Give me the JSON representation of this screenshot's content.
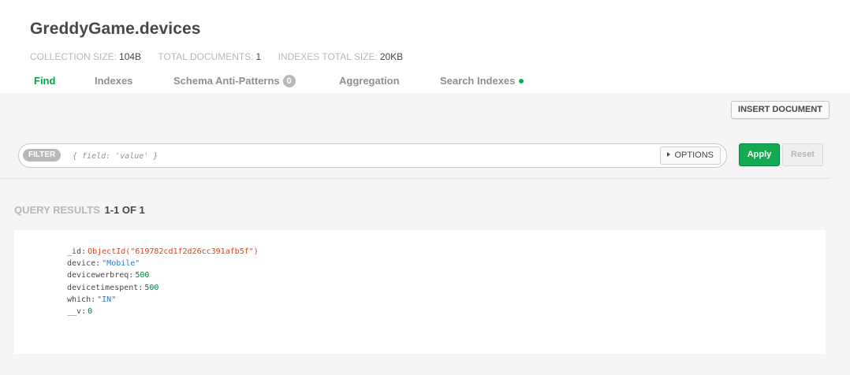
{
  "collection": {
    "title": "GreddyGame.devices"
  },
  "stats": [
    {
      "label": "COLLECTION SIZE:",
      "value": "104B"
    },
    {
      "label": "TOTAL DOCUMENTS:",
      "value": "1"
    },
    {
      "label": "INDEXES TOTAL SIZE:",
      "value": "20KB"
    }
  ],
  "tabs": {
    "find": "Find",
    "indexes": "Indexes",
    "schema": "Schema Anti-Patterns",
    "schema_badge": "0",
    "aggregation": "Aggregation",
    "search_indexes": "Search Indexes"
  },
  "toolbar": {
    "insert_document": "INSERT DOCUMENT"
  },
  "query": {
    "filter_tag": "FILTER",
    "filter_placeholder": "{ field: 'value' }",
    "filter_value": "",
    "options_label": "OPTIONS",
    "apply_label": "Apply",
    "reset_label": "Reset"
  },
  "results": {
    "label": "QUERY RESULTS",
    "count": "1-1 OF 1"
  },
  "document": {
    "fields": [
      {
        "key": "_id",
        "value": "ObjectId(\"619782cd1f2d26cc391afb5f\")",
        "type": "oid"
      },
      {
        "key": "device",
        "value": "\"Mobile\"",
        "type": "str"
      },
      {
        "key": "devicewerbreq",
        "value": "500",
        "type": "num"
      },
      {
        "key": "devicetimespent",
        "value": "500",
        "type": "num"
      },
      {
        "key": "which",
        "value": "\"IN\"",
        "type": "str"
      },
      {
        "key": "__v",
        "value": "0",
        "type": "num"
      }
    ]
  },
  "colors": {
    "accent_green": "#13aa52",
    "active_tab": "#0e9e4b",
    "objectid": "#e0401c",
    "string": "#2f78c4",
    "number": "#0b7a43"
  }
}
